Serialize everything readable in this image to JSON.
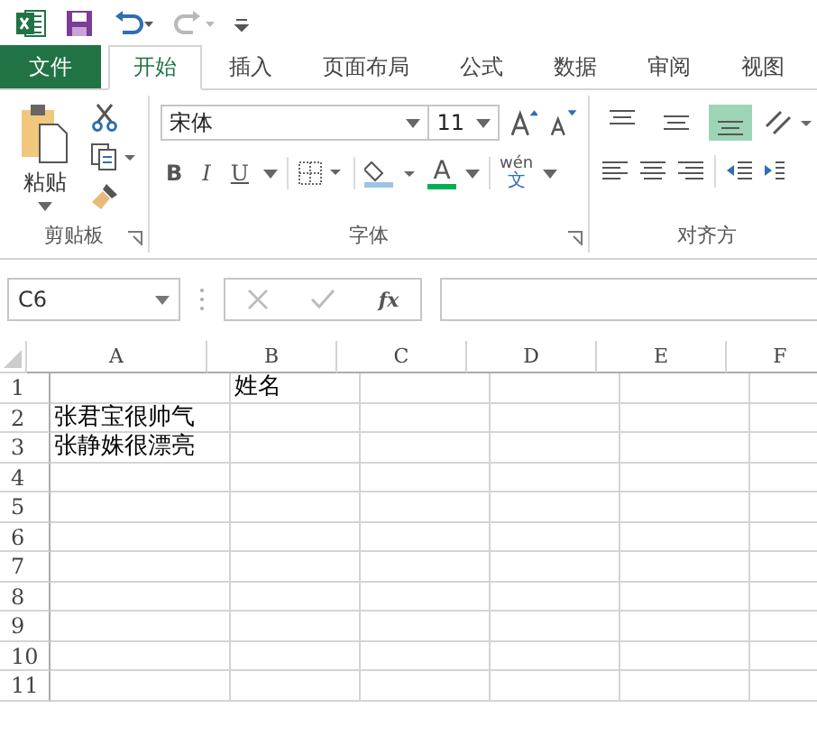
{
  "quick_access": {
    "undo_enabled": true,
    "redo_enabled": false
  },
  "tabs": [
    {
      "label": "文件",
      "kind": "file",
      "selected": false
    },
    {
      "label": "开始",
      "kind": "tab",
      "selected": true
    },
    {
      "label": "插入",
      "kind": "tab",
      "selected": false
    },
    {
      "label": "页面布局",
      "kind": "tab",
      "selected": false
    },
    {
      "label": "公式",
      "kind": "tab",
      "selected": false
    },
    {
      "label": "数据",
      "kind": "tab",
      "selected": false
    },
    {
      "label": "审阅",
      "kind": "tab",
      "selected": false
    },
    {
      "label": "视图",
      "kind": "tab",
      "selected": false
    }
  ],
  "clipboard": {
    "paste_label": "粘贴",
    "group_label": "剪贴板"
  },
  "font": {
    "font_name": "宋体",
    "font_size": "11",
    "bold": "B",
    "italic": "I",
    "underline": "U",
    "font_color_letter": "A",
    "phonetic_label": "wén",
    "phonetic_char": "文",
    "group_label": "字体"
  },
  "alignment": {
    "vertical": [
      {
        "kind": "top",
        "selected": false
      },
      {
        "kind": "middle",
        "selected": false
      },
      {
        "kind": "bottom",
        "selected": true
      }
    ],
    "group_label": "对齐方"
  },
  "formula_bar": {
    "name_box": "C6",
    "function_label": "fx"
  },
  "sheet": {
    "columns": [
      "A",
      "B",
      "C",
      "D",
      "E",
      "F"
    ],
    "rows": [
      {
        "number": "1",
        "cells": {
          "B": "姓名"
        }
      },
      {
        "number": "2",
        "cells": {
          "A": "张君宝很帅气"
        }
      },
      {
        "number": "3",
        "cells": {
          "A": "张静姝很漂亮"
        }
      },
      {
        "number": "4",
        "cells": {}
      },
      {
        "number": "5",
        "cells": {}
      },
      {
        "number": "6",
        "cells": {}
      },
      {
        "number": "7",
        "cells": {}
      },
      {
        "number": "8",
        "cells": {}
      },
      {
        "number": "9",
        "cells": {}
      },
      {
        "number": "10",
        "cells": {}
      },
      {
        "number": "11",
        "cells": {}
      }
    ]
  }
}
